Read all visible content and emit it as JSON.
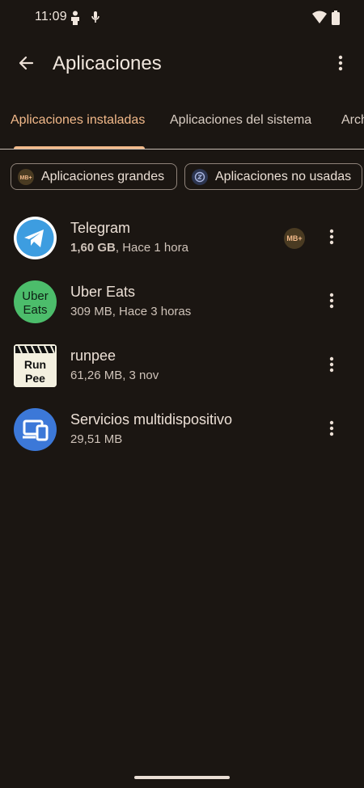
{
  "status_bar": {
    "time": "11:09",
    "icons": [
      "person-icon",
      "mic-icon",
      "wifi-icon",
      "battery-icon"
    ]
  },
  "app_bar": {
    "title": "Aplicaciones",
    "icons": [
      "back-arrow-icon",
      "more-vert-icon"
    ]
  },
  "tabs": [
    {
      "label": "Aplicaciones instaladas",
      "selected": true
    },
    {
      "label": "Aplicaciones del sistema",
      "selected": false
    },
    {
      "label": "Arch",
      "selected": false
    }
  ],
  "chips": [
    {
      "label": "Aplicaciones grandes",
      "icon": "mb-plus-icon"
    },
    {
      "label": "Aplicaciones no usadas",
      "icon": "unused-clock-icon"
    }
  ],
  "apps": [
    {
      "name": "Telegram",
      "size": "1,60 GB",
      "detail_rest": ", Hace 1 hora",
      "icon": "telegram-icon",
      "badge": "mb-plus-icon"
    },
    {
      "name": "Uber Eats",
      "detail": "309 MB, Hace 3 horas",
      "icon": "uber-eats-icon",
      "icon_text": [
        "Uber",
        "Eats"
      ]
    },
    {
      "name": "runpee",
      "detail": "61,26 MB, 3 nov",
      "icon": "runpee-icon",
      "icon_text": [
        "Run",
        "Pee"
      ]
    },
    {
      "name": "Servicios multidispositivo",
      "detail": "29,51 MB",
      "icon": "multidevice-icon"
    }
  ],
  "badge_text": "MB+",
  "colors": {
    "background": "#1b1612",
    "accent": "#f2b98a",
    "telegram": "#3d9de0",
    "uber_eats": "#4cbd6b",
    "multidevice": "#3c78d8"
  }
}
